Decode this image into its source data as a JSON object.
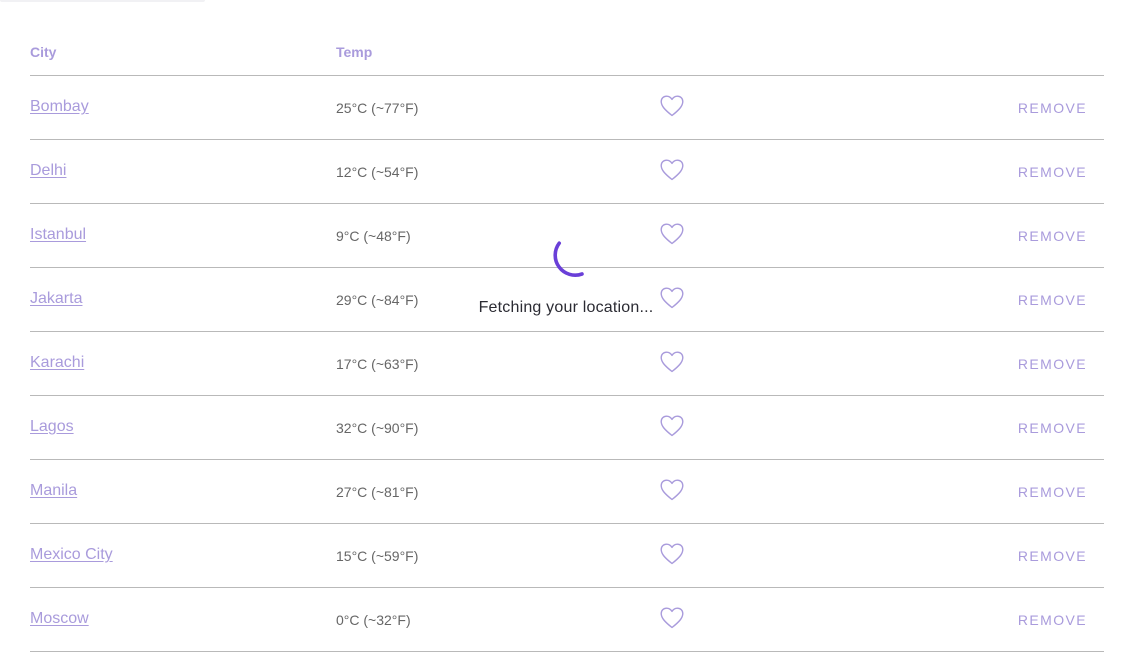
{
  "header": {
    "city": "City",
    "temp": "Temp"
  },
  "rows": [
    {
      "city": "Bombay",
      "temp": "25°C (~77°F)",
      "action": "REMOVE"
    },
    {
      "city": "Delhi",
      "temp": "12°C (~54°F)",
      "action": "REMOVE"
    },
    {
      "city": "Istanbul",
      "temp": "9°C (~48°F)",
      "action": "REMOVE"
    },
    {
      "city": "Jakarta",
      "temp": "29°C (~84°F)",
      "action": "REMOVE"
    },
    {
      "city": "Karachi",
      "temp": "17°C (~63°F)",
      "action": "REMOVE"
    },
    {
      "city": "Lagos",
      "temp": "32°C (~90°F)",
      "action": "REMOVE"
    },
    {
      "city": "Manila",
      "temp": "27°C (~81°F)",
      "action": "REMOVE"
    },
    {
      "city": "Mexico City",
      "temp": "15°C (~59°F)",
      "action": "REMOVE"
    },
    {
      "city": "Moscow",
      "temp": "0°C (~32°F)",
      "action": "REMOVE"
    }
  ],
  "loader": {
    "text": "Fetching your location..."
  },
  "icons": {
    "favorite": "heart-outline-icon",
    "loading": "spinner-icon"
  },
  "colors": {
    "accent": "#a99bdc",
    "spinner": "#6a3fd8",
    "text": "#666666",
    "divider": "#b9b9b9"
  }
}
